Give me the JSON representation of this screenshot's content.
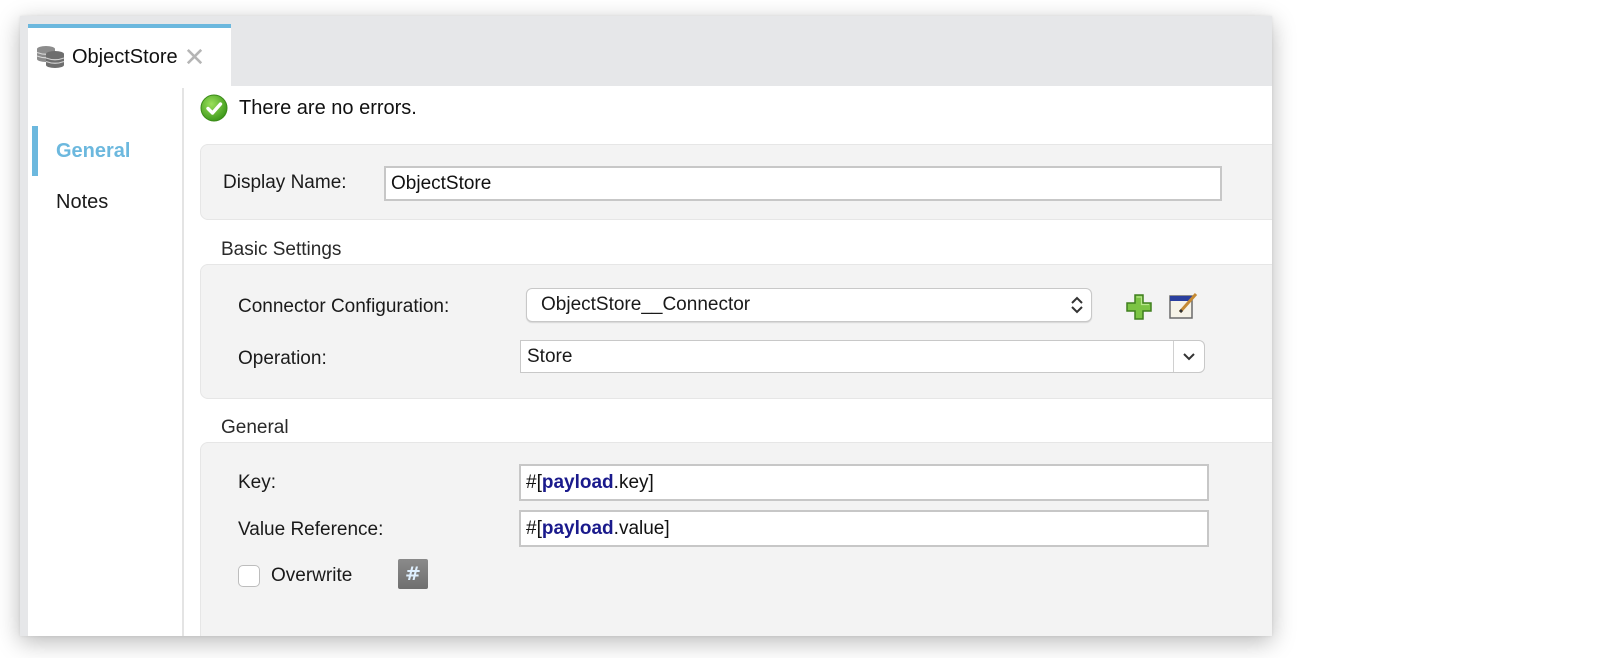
{
  "tab": {
    "title": "ObjectStore",
    "icon": "database-icon",
    "close_glyph": "✕"
  },
  "sidebar": {
    "items": [
      {
        "label": "General",
        "active": true
      },
      {
        "label": "Notes",
        "active": false
      }
    ]
  },
  "status": {
    "icon": "check-circle-icon",
    "text": "There are no errors."
  },
  "display_name": {
    "label": "Display Name:",
    "value": "ObjectStore"
  },
  "basic_settings": {
    "title": "Basic Settings",
    "connector_configuration": {
      "label": "Connector Configuration:",
      "value": "ObjectStore__Connector",
      "add_icon": "plus-icon",
      "edit_icon": "edit-config-icon"
    },
    "operation": {
      "label": "Operation:",
      "value": "Store"
    }
  },
  "general": {
    "title": "General",
    "key": {
      "label": "Key:",
      "prefix": "#[",
      "keyword": "payload",
      "suffix": ".key]"
    },
    "value_reference": {
      "label": "Value Reference:",
      "prefix": "#[",
      "keyword": "payload",
      "suffix": ".value]"
    },
    "overwrite": {
      "label": "Overwrite",
      "checked": false,
      "expression_glyph": "#"
    }
  },
  "colors": {
    "accent": "#6cb8de",
    "keyword": "#1a1a8c",
    "success": "#5cb82a",
    "add_green": "#6dbb3a"
  }
}
